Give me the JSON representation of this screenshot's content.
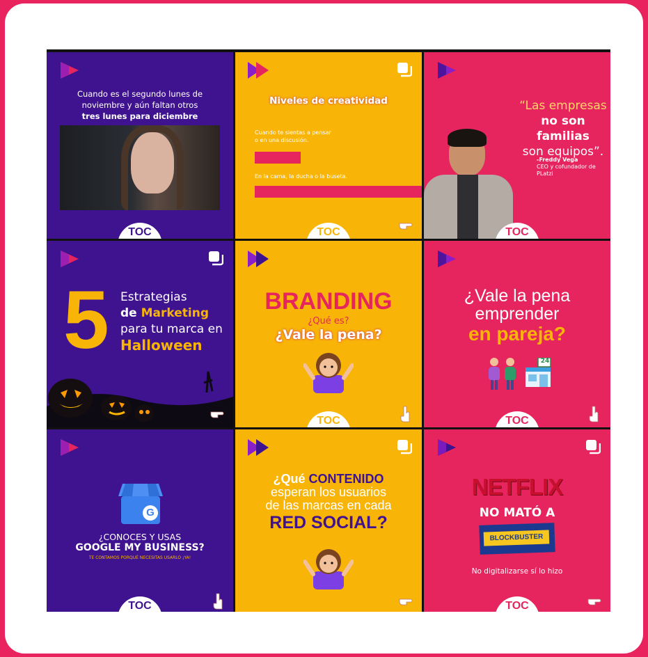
{
  "tiles": {
    "t1": {
      "line1": "Cuando es el segundo lunes de",
      "line2": "noviembre y aún faltan otros",
      "line3": "tres lunes para diciembre",
      "logo": "TOC"
    },
    "t2": {
      "title": "Niveles de creatividad",
      "line1": "Cuando te sientas a pensar",
      "line2": "o en una discusión.",
      "line3": "En la cama, la ducha o la buseta.",
      "logo": "TOC"
    },
    "t3": {
      "quote1": "“Las empresas",
      "quote2": "no son familias",
      "quote3": "son equipos”.",
      "author": "-Freddy Vega",
      "role": "CEO y cofundador de PLatzi",
      "logo": "TOC"
    },
    "t4": {
      "number": "5",
      "line1": "Estrategias",
      "line2a": "de ",
      "line2b": "Marketing",
      "line3": "para tu marca en",
      "line4": "Halloween"
    },
    "t5": {
      "title": "BRANDING",
      "line1": "¿Qué es?",
      "line2": "¿Vale la pena?",
      "logo": "TOC"
    },
    "t6": {
      "line1": "¿Vale la pena",
      "line2": "emprender",
      "line3": "en pareja?",
      "badge": "24",
      "logo": "TOC"
    },
    "t7": {
      "line1": "¿CONOCES Y USAS",
      "line2": "GOOGLE MY BUSINESS?",
      "line3": "TE CONTAMOS PORQUÉ NECESITAS USARLO ¡YA!",
      "g": "G",
      "logo": "TOC"
    },
    "t8": {
      "line1a": "¿Qué ",
      "line1b": "CONTENIDO",
      "line2": "esperan los usuarios",
      "line3": "de las marcas en cada",
      "line4": "RED SOCIAL?"
    },
    "t9": {
      "brand1": "NETFLIX",
      "line1": "NO MATÓ A",
      "brand2": "BLOCKBUSTER",
      "line2": "No digitalizarse sí lo hizo",
      "logo": "TOC"
    }
  },
  "colors": {
    "purple": "#3f1290",
    "yellow": "#f9b408",
    "pink": "#e6245d",
    "background": "#e8235e"
  },
  "icons": [
    "play-logo-icon",
    "copy-icon",
    "pointing-hand-icon",
    "shrug-emoji-icon",
    "couple-icon",
    "store-icon",
    "google-my-business-icon",
    "pumpkin-icon"
  ]
}
